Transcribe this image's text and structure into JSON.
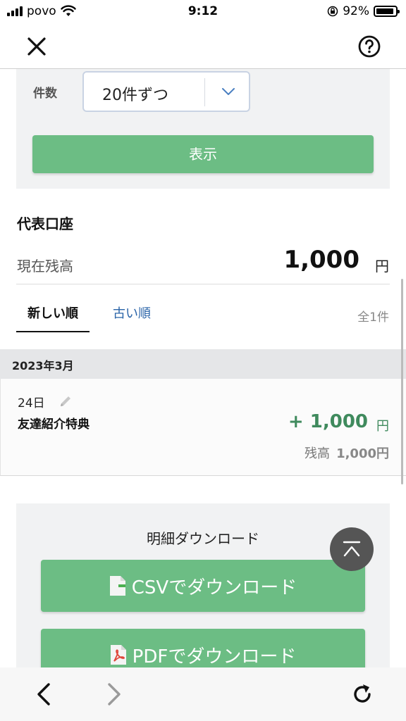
{
  "status_bar": {
    "carrier": "povo",
    "time": "9:12",
    "battery": "92%",
    "battery_level": 0.92
  },
  "header": {
    "close_icon": "close-icon",
    "help_icon": "help-icon"
  },
  "filter": {
    "label": "件数",
    "selected": "20件ずつ",
    "show_button": "表示"
  },
  "account": {
    "title": "代表口座",
    "balance_label": "現在残高",
    "balance_value": "1,000",
    "currency": "円"
  },
  "tabs": {
    "newest": "新しい順",
    "oldest": "古い順",
    "total": "全1件",
    "active": "newest"
  },
  "transactions": {
    "month": "2023年3月",
    "items": [
      {
        "day": "24日",
        "description": "友達紹介特典",
        "amount": "+ 1,000",
        "unit": "円",
        "balance_label": "残高",
        "balance": "1,000円"
      }
    ]
  },
  "download": {
    "title": "明細ダウンロード",
    "csv_label": "CSVでダウンロード",
    "pdf_label": "PDFでダウンロード"
  },
  "colors": {
    "accent_green": "#6cbd84",
    "amount_green": "#3f8a5d",
    "link_blue": "#2a64a8"
  }
}
